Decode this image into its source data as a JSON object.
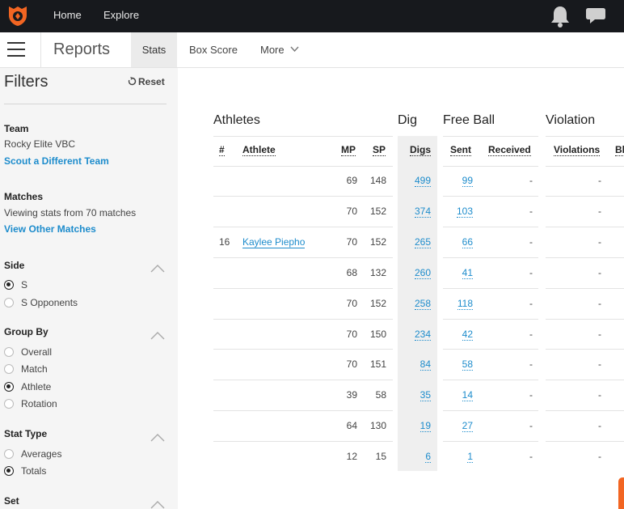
{
  "nav": {
    "home": "Home",
    "explore": "Explore"
  },
  "subnav": {
    "title": "Reports",
    "tabs": [
      "Stats",
      "Box Score",
      "More"
    ]
  },
  "filters": {
    "title": "Filters",
    "reset": "Reset",
    "team": {
      "label": "Team",
      "value": "Rocky Elite VBC",
      "link": "Scout a Different Team"
    },
    "matches": {
      "label": "Matches",
      "value": "Viewing stats from 70 matches",
      "link": "View Other Matches"
    },
    "side": {
      "label": "Side",
      "options": [
        "S",
        "S Opponents"
      ],
      "selected": 0
    },
    "group_by": {
      "label": "Group By",
      "options": [
        "Overall",
        "Match",
        "Athlete",
        "Rotation"
      ],
      "selected": 2
    },
    "stat_type": {
      "label": "Stat Type",
      "options": [
        "Averages",
        "Totals"
      ],
      "selected": 1
    },
    "set": {
      "label": "Set"
    }
  },
  "table": {
    "groups": [
      "Athletes",
      "Dig",
      "Free Ball",
      "Violation"
    ],
    "headers": [
      "#",
      "Athlete",
      "MP",
      "SP",
      "Digs",
      "Sent",
      "Received",
      "Violations",
      "Bl"
    ],
    "rows": [
      {
        "num": "",
        "athlete": "",
        "mp": "69",
        "sp": "148",
        "digs": "499",
        "sent": "99",
        "received": "-",
        "violations": "-"
      },
      {
        "num": "",
        "athlete": "",
        "mp": "70",
        "sp": "152",
        "digs": "374",
        "sent": "103",
        "received": "-",
        "violations": "-"
      },
      {
        "num": "16",
        "athlete": "Kaylee Piepho",
        "mp": "70",
        "sp": "152",
        "digs": "265",
        "sent": "66",
        "received": "-",
        "violations": "-"
      },
      {
        "num": "",
        "athlete": "",
        "mp": "68",
        "sp": "132",
        "digs": "260",
        "sent": "41",
        "received": "-",
        "violations": "-"
      },
      {
        "num": "",
        "athlete": "",
        "mp": "70",
        "sp": "152",
        "digs": "258",
        "sent": "118",
        "received": "-",
        "violations": "-"
      },
      {
        "num": "",
        "athlete": "",
        "mp": "70",
        "sp": "150",
        "digs": "234",
        "sent": "42",
        "received": "-",
        "violations": "-"
      },
      {
        "num": "",
        "athlete": "",
        "mp": "70",
        "sp": "151",
        "digs": "84",
        "sent": "58",
        "received": "-",
        "violations": "-"
      },
      {
        "num": "",
        "athlete": "",
        "mp": "39",
        "sp": "58",
        "digs": "35",
        "sent": "14",
        "received": "-",
        "violations": "-"
      },
      {
        "num": "",
        "athlete": "",
        "mp": "64",
        "sp": "130",
        "digs": "19",
        "sent": "27",
        "received": "-",
        "violations": "-"
      },
      {
        "num": "",
        "athlete": "",
        "mp": "12",
        "sp": "15",
        "digs": "6",
        "sent": "1",
        "received": "-",
        "violations": "-"
      }
    ]
  },
  "colors": {
    "topbar": "#17191d",
    "link": "#1d8ccc",
    "accent": "#f26522",
    "sidebar": "#f5f5f5"
  },
  "icons": [
    "logo-icon",
    "bell-icon",
    "chat-icon",
    "menu-icon",
    "chevron-down-icon",
    "reset-icon",
    "chevron-up-icon"
  ]
}
